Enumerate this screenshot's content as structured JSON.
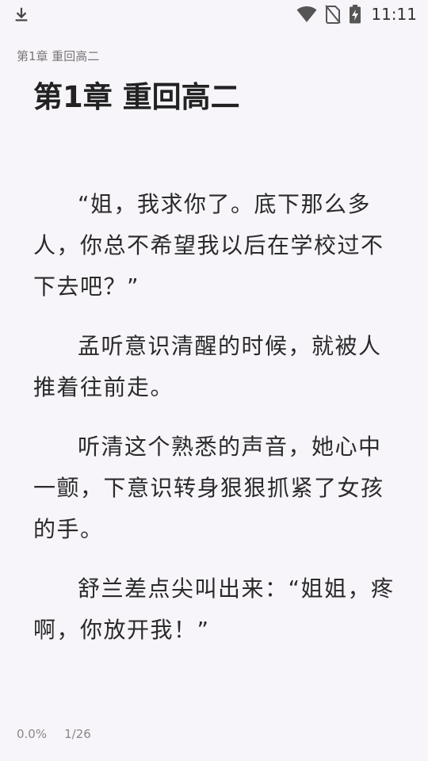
{
  "status_bar": {
    "time": "11:11",
    "icons": [
      "download-icon",
      "wifi-icon",
      "no-sim-icon",
      "battery-charging-icon"
    ]
  },
  "reader": {
    "running_header": "第1章 重回高二",
    "chapter_title": "第1章 重回高二",
    "paragraphs": [
      "“姐，我求你了。底下那么多人，你总不希望我以后在学校过不下去吧？”",
      "孟听意识清醒的时候，就被人推着往前走。",
      "听清这个熟悉的声音，她心中一颤，下意识转身狠狠抓紧了女孩的手。",
      "舒兰差点尖叫出来：“姐姐，疼啊，你放开我！”"
    ],
    "progress_percent": "0.0%",
    "page_indicator": "1/26"
  }
}
